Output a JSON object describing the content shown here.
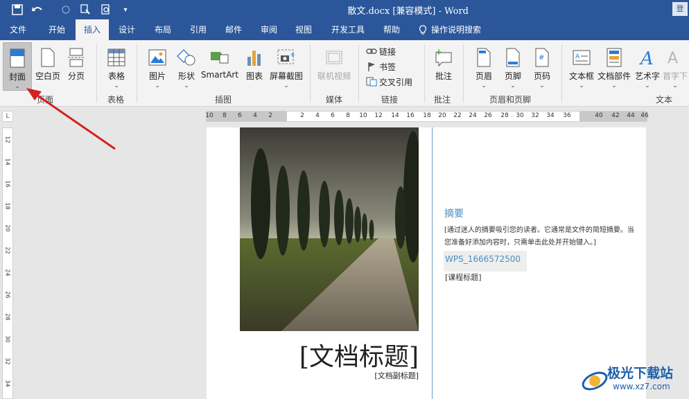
{
  "window": {
    "title": "散文.docx [兼容模式]  -  Word"
  },
  "tabs": [
    "文件",
    "开始",
    "插入",
    "设计",
    "布局",
    "引用",
    "邮件",
    "审阅",
    "视图",
    "开发工具",
    "帮助",
    "操作说明搜索"
  ],
  "ribbon": {
    "pages": {
      "cover": "封面",
      "blank": "空白页",
      "break": "分页",
      "group": "页面"
    },
    "tables": {
      "table": "表格",
      "group": "表格"
    },
    "illustrations": {
      "picture": "图片",
      "shapes": "形状",
      "smartart": "SmartArt",
      "chart": "图表",
      "screenshot": "屏幕截图",
      "group": "插图"
    },
    "media": {
      "video": "联机视频",
      "group": "媒体"
    },
    "links": {
      "link": "链接",
      "bookmark": "书签",
      "crossref": "交叉引用",
      "group": "链接"
    },
    "comments": {
      "comment": "批注",
      "group": "批注"
    },
    "header_footer": {
      "header": "页眉",
      "footer": "页脚",
      "page_number": "页码",
      "group": "页眉和页脚"
    },
    "text": {
      "textbox": "文本框",
      "quickparts": "文档部件",
      "wordart": "艺术字",
      "dropcap": "首字下",
      "group": "文本"
    }
  },
  "ruler": {
    "h_ticks": [
      "10",
      "8",
      "6",
      "4",
      "2",
      "2",
      "4",
      "6",
      "8",
      "10",
      "12",
      "14",
      "16",
      "18",
      "20",
      "22",
      "24",
      "26",
      "28",
      "30",
      "32",
      "34",
      "36",
      "40",
      "42",
      "44",
      "46"
    ],
    "v_ticks": [
      "12",
      "14",
      "16",
      "18",
      "20",
      "22",
      "24",
      "26",
      "28",
      "30",
      "32",
      "34"
    ],
    "corner": "L"
  },
  "document": {
    "summary_title": "摘要",
    "summary_body": "[通过迷人的摘要吸引您的读者。它通常是文件的简短摘要。当您准备好添加内容时，只需单击此处并开始键入。]",
    "author": "WPS_1666572500",
    "course_title": "[课程标题]",
    "doc_title": "[文档标题]",
    "doc_subtitle": "[文档副标题]"
  },
  "watermark": {
    "name": "极光下载站",
    "url": "www.xz7.com"
  },
  "colors": {
    "accent": "#2b579a",
    "arrow": "#d42020",
    "link_blue": "#4a8fbd"
  }
}
